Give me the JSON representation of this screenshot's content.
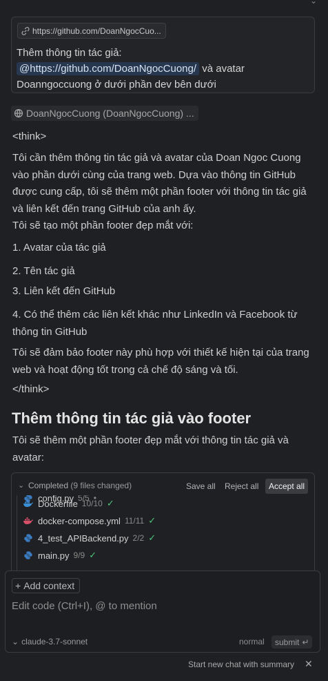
{
  "user_message": {
    "url_chip": "https://github.com/DoanNgocCuo...",
    "text_before": "Thêm thông tin tác giả: ",
    "mention": "@https://github.com/DoanNgocCuong/",
    "text_after": " và avatar Doanngoccuong ở dưới phần dev bên dưới"
  },
  "reference_chip": "DoanNgocCuong (DoanNgocCuong) ...",
  "response": {
    "think_open": "<think>",
    "p1": "Tôi cần thêm thông tin tác giả và avatar của Doan Ngoc Cuong vào phần dưới cùng của trang web. Dựa vào thông tin GitHub được cung cấp, tôi sẽ thêm một phần footer với thông tin tác giả và liên kết đến trang GitHub của anh ấy.",
    "p2": "Tôi sẽ tạo một phần footer đẹp mắt với:",
    "item1": "1. Avatar của tác giả",
    "item2": "2. Tên tác giả",
    "item3": "3. Liên kết đến GitHub",
    "item4": "4. Có thể thêm các liên kết khác như LinkedIn và Facebook từ thông tin GitHub",
    "p3": "Tôi sẽ đảm bảo footer này phù hợp với thiết kế hiện tại của trang web và hoạt động tốt trong cả chế độ sáng và tối.",
    "think_close": "</think>",
    "heading": "Thêm thông tin tác giả vào footer",
    "p4": "Tôi sẽ thêm một phần footer đẹp mắt với thông tin tác giả và avatar:"
  },
  "changes": {
    "status": "Completed",
    "files_changed": "(9 files changed)",
    "save_all": "Save all",
    "reject_all": "Reject all",
    "accept_all": "Accept all",
    "files": [
      {
        "name": "config.py",
        "count": "5/5",
        "icon": "python-icon",
        "mark": "•"
      },
      {
        "name": "Dockerfile",
        "count": "10/10",
        "icon": "docker-icon",
        "mark": "✓"
      },
      {
        "name": "docker-compose.yml",
        "count": "11/11",
        "icon": "yaml-icon",
        "mark": "✓"
      },
      {
        "name": "4_test_APIBackend.py",
        "count": "2/2",
        "icon": "python-icon",
        "mark": "✓"
      },
      {
        "name": "main.py",
        "count": "9/9",
        "icon": "python-icon",
        "mark": "✓"
      }
    ]
  },
  "composer": {
    "add_context": "Add context",
    "placeholder": "Edit code (Ctrl+I), @ to mention",
    "model": "claude-3.7-sonnet",
    "mode": "normal",
    "submit": "submit"
  },
  "footer": {
    "new_chat": "Start new chat with summary"
  },
  "colors": {
    "background": "#1f2023",
    "mention_bg": "#26374f",
    "check": "#4ec37a",
    "docker_icon": "#3b8fd4",
    "yaml_icon": "#d6506a",
    "python_icon": "#3b7bbf"
  }
}
